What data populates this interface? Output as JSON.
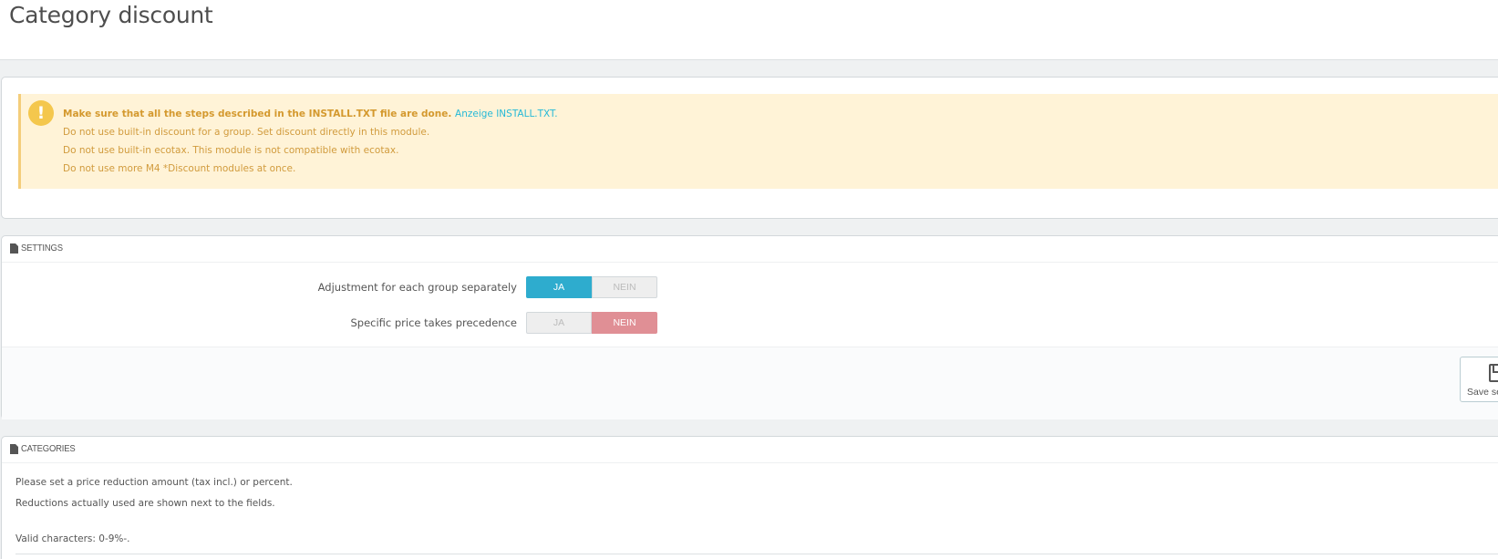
{
  "page": {
    "title": "Category discount"
  },
  "alert": {
    "icon": "exclamation-circle-icon",
    "line1_bold": "Make sure that all the steps described in the INSTALL.TXT file are done.",
    "line1_link": "Anzeige INSTALL.TXT.",
    "line2": "Do not use built-in discount for a group. Set discount directly in this module.",
    "line3": "Do not use built-in ecotax. This module is not compatible with ecotax.",
    "line4": "Do not use more M4 *Discount modules at once.",
    "background_color": "#fff3d7",
    "text_color": "#d19b3d",
    "link_color": "#25b9d7"
  },
  "settings": {
    "heading": "SETTINGS",
    "heading_icon": "file-icon",
    "rows": [
      {
        "label": "Adjustment for each group separately",
        "yes_label": "JA",
        "no_label": "NEIN",
        "value": "JA"
      },
      {
        "label": "Specific price takes precedence",
        "yes_label": "JA",
        "no_label": "NEIN",
        "value": "NEIN"
      }
    ],
    "save_label": "Save se",
    "save_icon": "floppy-disk-icon",
    "yes_color": "#2eacce",
    "no_color": "#e08f95"
  },
  "categories": {
    "heading": "CATEGORIES",
    "heading_icon": "file-icon",
    "text1": "Please set a price reduction amount (tax incl.) or percent.",
    "text2": "Reductions actually used are shown next to the fields.",
    "text3": "Valid characters: 0-9%-."
  }
}
